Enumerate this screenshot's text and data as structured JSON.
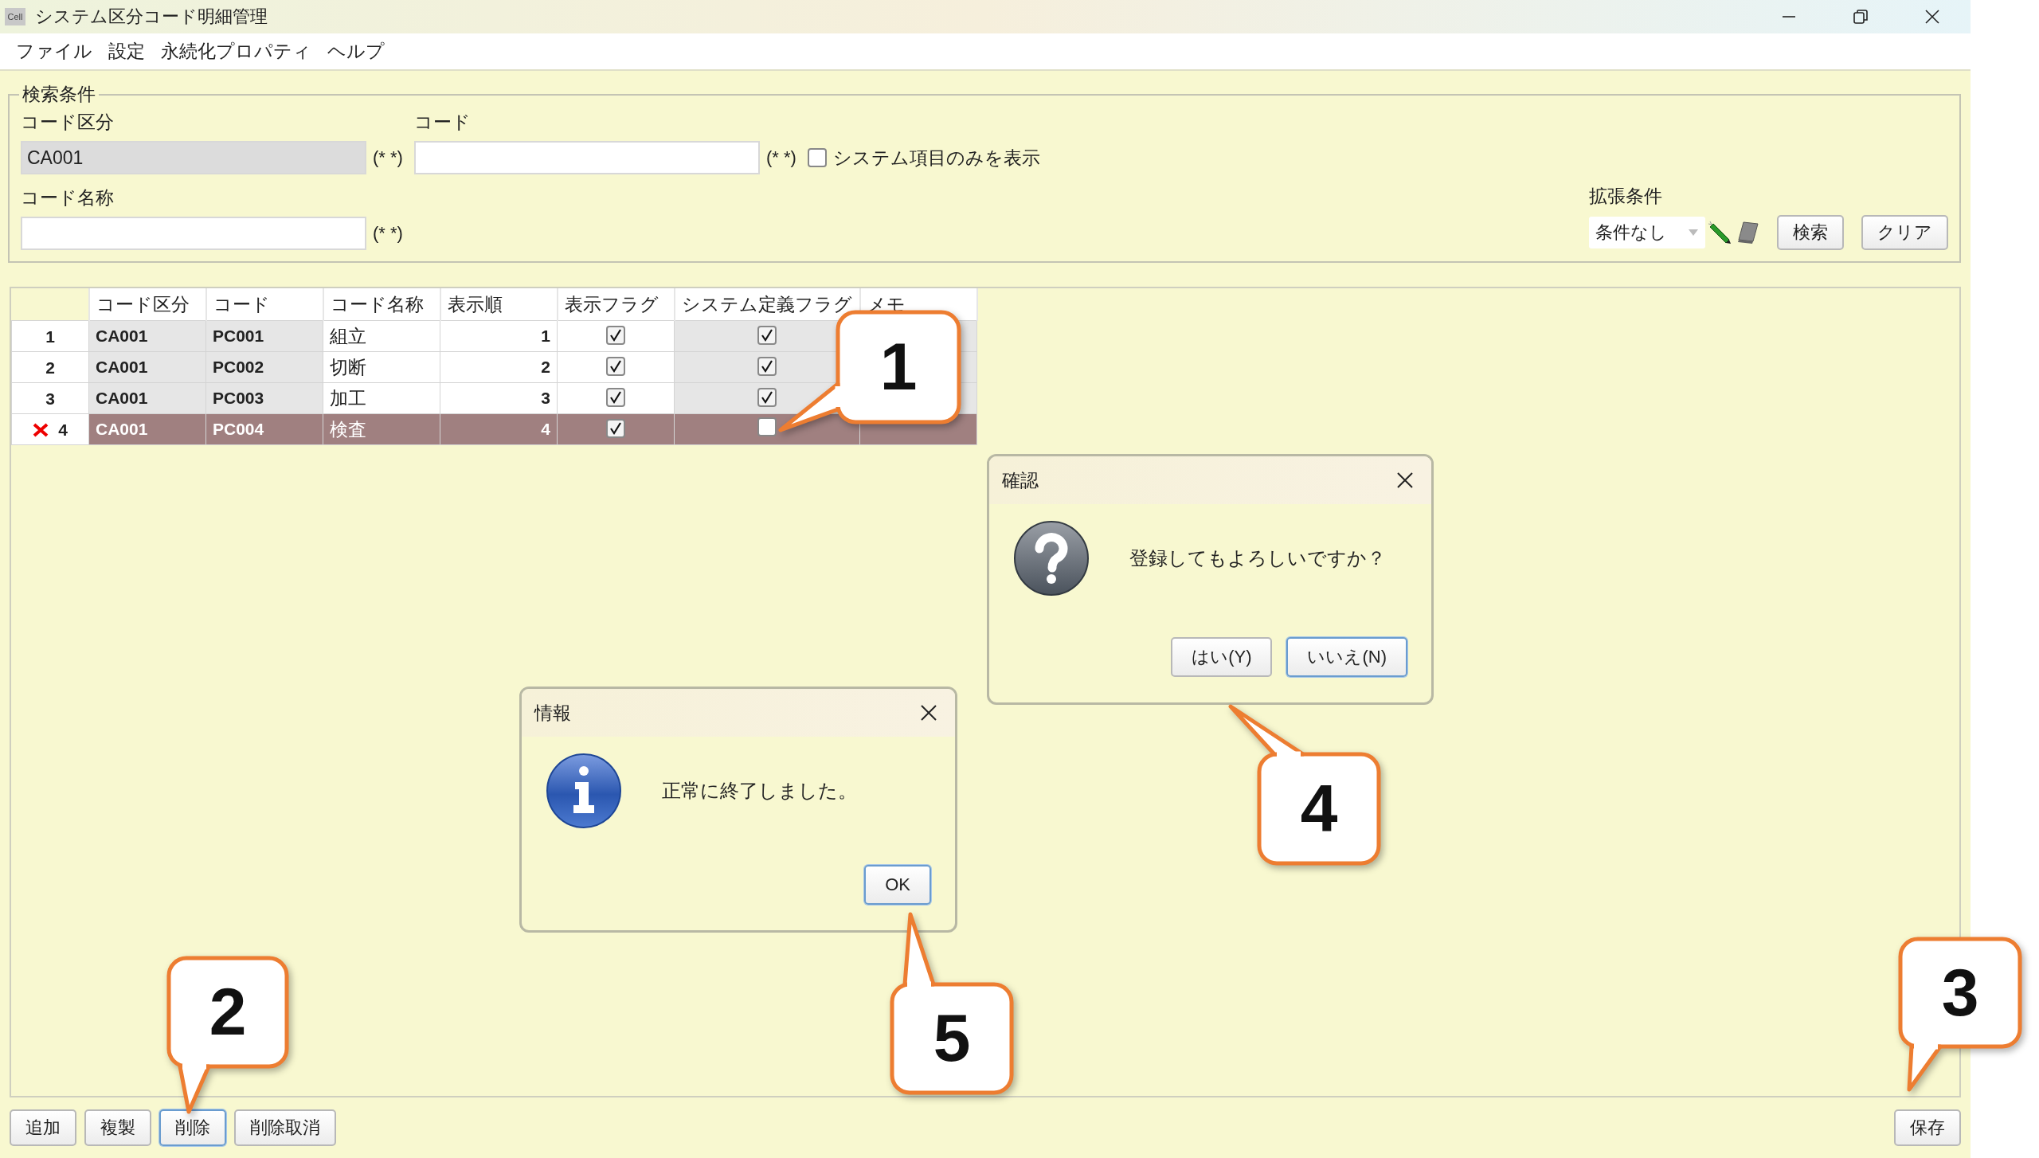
{
  "window": {
    "title": "システム区分コード明細管理",
    "app_icon_text": "Cell"
  },
  "menu": [
    "ファイル",
    "設定",
    "永続化プロパティ",
    "ヘルプ"
  ],
  "search": {
    "legend": "検索条件",
    "code_category": {
      "label": "コード区分",
      "value": "CA001",
      "disabled": true,
      "suffix": "(* *)"
    },
    "code": {
      "label": "コード",
      "disabled": false,
      "suffix": "(* *)"
    },
    "system_only": {
      "label": "システム項目のみを表示",
      "checked": false
    },
    "code_name": {
      "label": "コード名称",
      "disabled": false,
      "suffix": "(* *)"
    },
    "extended": {
      "label": "拡張条件",
      "value": "条件なし"
    },
    "buttons": [
      "検索",
      "クリア"
    ]
  },
  "table": {
    "columns": [
      "コード区分",
      "コード",
      "コード名称",
      "表示順",
      "表示フラグ",
      "システム定義フラグ",
      "メモ"
    ],
    "rows": [
      {
        "row_header": "1",
        "deleted": false,
        "cells": [
          "CA001",
          "PC001",
          "組立",
          "1"
        ],
        "display_flag": true,
        "system_flag": true
      },
      {
        "row_header": "2",
        "deleted": false,
        "cells": [
          "CA001",
          "PC002",
          "切断",
          "2"
        ],
        "display_flag": true,
        "system_flag": true
      },
      {
        "row_header": "3",
        "deleted": false,
        "cells": [
          "CA001",
          "PC003",
          "加工",
          "3"
        ],
        "display_flag": true,
        "system_flag": true
      },
      {
        "row_header": "4",
        "deleted": true,
        "cells": [
          "CA001",
          "PC004",
          "検査",
          "4"
        ],
        "display_flag": true,
        "system_flag": false
      }
    ]
  },
  "bottom_buttons_left": [
    {
      "label": "追加",
      "focused": false
    },
    {
      "label": "複製",
      "focused": false
    },
    {
      "label": "削除",
      "focused": true
    },
    {
      "label": "削除取消",
      "focused": false
    }
  ],
  "bottom_buttons_right": [
    {
      "label": "保存",
      "focused": false
    }
  ],
  "dialogs": [
    {
      "kind": "question",
      "title": "確認",
      "message": "登録してもよろしいですか？",
      "buttons": [
        {
          "label": "はい(Y)",
          "focused": false
        },
        {
          "label": "いいえ(N)",
          "focused": true
        }
      ]
    },
    {
      "kind": "info",
      "title": "情報",
      "message": "正常に終了しました。",
      "buttons": [
        {
          "label": "OK",
          "focused": true
        }
      ]
    }
  ],
  "callouts": [
    {
      "label": "1"
    },
    {
      "label": "2"
    },
    {
      "label": "3"
    },
    {
      "label": "4"
    },
    {
      "label": "5"
    }
  ]
}
